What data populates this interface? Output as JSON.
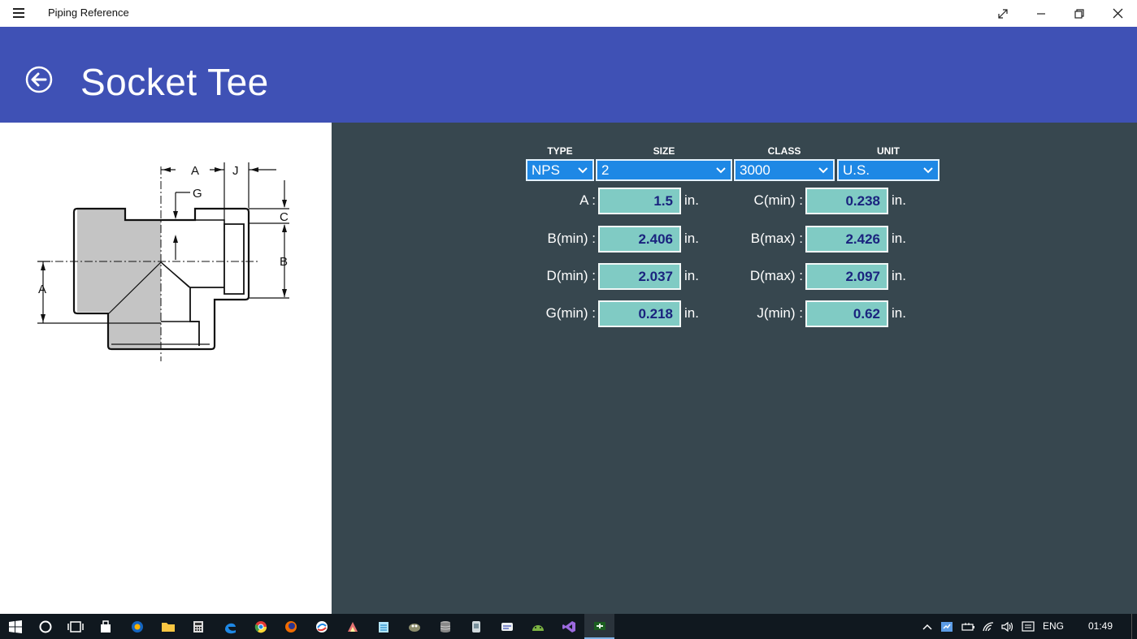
{
  "app": {
    "title": "Piping Reference"
  },
  "page": {
    "title": "Socket Tee"
  },
  "selectors": [
    {
      "label": "TYPE",
      "value": "NPS"
    },
    {
      "label": "SIZE",
      "value": "2"
    },
    {
      "label": "CLASS",
      "value": "3000"
    },
    {
      "label": "UNIT",
      "value": "U.S."
    }
  ],
  "dimensions": {
    "left": [
      {
        "label": "A :",
        "value": "1.5",
        "unit": "in."
      },
      {
        "label": "B(min) :",
        "value": "2.406",
        "unit": "in."
      },
      {
        "label": "D(min) :",
        "value": "2.037",
        "unit": "in."
      },
      {
        "label": "G(min) :",
        "value": "0.218",
        "unit": "in."
      }
    ],
    "right": [
      {
        "label": "C(min) :",
        "value": "0.238",
        "unit": "in."
      },
      {
        "label": "B(max) :",
        "value": "2.426",
        "unit": "in."
      },
      {
        "label": "D(max) :",
        "value": "2.097",
        "unit": "in."
      },
      {
        "label": "J(min) :",
        "value": "0.62",
        "unit": "in."
      }
    ]
  },
  "diagram": {
    "labels": [
      "A",
      "J",
      "G",
      "C",
      "B",
      "A"
    ]
  },
  "taskbar": {
    "apps": [
      "start-icon",
      "cortana-icon",
      "task-view-icon",
      "store-icon",
      "app-icon",
      "file-explorer-icon",
      "calculator-icon",
      "edge-icon",
      "chrome-icon",
      "firefox-icon",
      "app-icon",
      "app-icon",
      "notepad-icon",
      "gimp-icon",
      "database-icon",
      "app-icon",
      "app-icon",
      "android-icon",
      "visual-studio-icon",
      "piping-reference-icon"
    ],
    "language": "ENG",
    "time": "01:49"
  },
  "colors": {
    "header": "#3f51b5",
    "right_pane": "#37474f",
    "select": "#1e88e5",
    "value_box": "#80cbc4",
    "value_text": "#1a237e"
  }
}
